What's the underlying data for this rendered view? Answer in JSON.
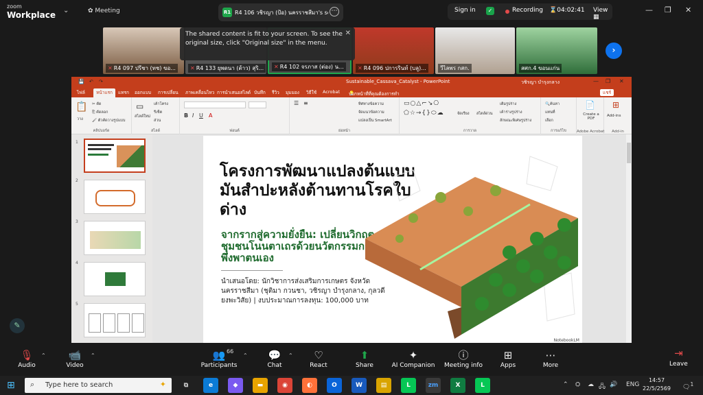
{
  "zoom": {
    "logo_top": "zoom",
    "logo_bottom": "Workplace",
    "meeting_label": "Meeting",
    "share_badge": "R1",
    "share_title": "R4 106 วชิรญา (ป้อ) นครราชสีมา's scr",
    "sign_in": "Sign in",
    "recording_label": "Recording",
    "elapsed_time": "04:02:41",
    "view_label": "View",
    "tooltip": "The shared content is fit to your screen. To see the original size, click \"Original size\" in the menu.",
    "participants": [
      {
        "name": "R4 097 ปรีชา (ทช) ขอ..."
      },
      {
        "name": "R4 133 ยุพดนา (ต้าว) สุริ..."
      },
      {
        "name": "R4 102 จรภาส (ต่อง) น..."
      },
      {
        "name": "R4 096 ปการรินท์ (บลู)..."
      },
      {
        "name": "วีไลพร กสก."
      },
      {
        "name": "สศก.4 ขอนแก่น"
      }
    ]
  },
  "ppt": {
    "title": "Sustainable_Cassava_Catalyst - PowerPoint",
    "user": "วชิรญา บำรุงกลาง",
    "tabs": [
      "ไฟล์",
      "หน้าแรก",
      "แทรก",
      "ออกแบบ",
      "การเปลี่ยน",
      "ภาพเคลื่อนไหว",
      "การนำเสนอสไลด์",
      "บันทึก",
      "รีวิว",
      "มุมมอง",
      "วิธีใช้",
      "Acrobat",
      "บอกหน้าที่ที่คุณต้องการทำ"
    ],
    "share_btn": "แชร์",
    "groups": {
      "clipboard": "คลิปบอร์ด",
      "slides": "สไลด์",
      "font": "ฟอนต์",
      "paragraph": "ย่อหน้า",
      "drawing": "การวาด",
      "editing": "การแก้ไข",
      "adobe": "Adobe Acrobat",
      "addins": "Add-in"
    },
    "buttons": {
      "paste": "วาง",
      "cut": "ตัด",
      "copy": "คัดลอก",
      "format_painter": "ตัวคัดวางรูปแบบ",
      "new_slide": "สไลด์ใหม่",
      "layout": "เค้าโครง",
      "reset": "รีเซ็ต",
      "section": "ส่วน",
      "text_direction": "ทิศทางข้อความ",
      "align_text": "จัดแนวข้อความ",
      "smartart": "แปลงเป็น SmartArt",
      "arrange": "จัดเรียง",
      "quick_styles": "สไตล์ด่วน",
      "shape_fill": "เติมรูปร่าง",
      "shape_outline": "เค้าร่างรูปร่าง",
      "shape_effects": "ลักษณะพิเศษรูปร่าง",
      "find": "ค้นหา",
      "replace": "แทนที่",
      "select": "เลือก",
      "create_pdf": "Create a PDF",
      "addins": "Add-ins"
    },
    "slide_numbers": [
      "1",
      "2",
      "3",
      "4",
      "5"
    ],
    "slide": {
      "title": "โครงการพัฒนาแปลงต้นแบบมันสำปะหลังต้านทานโรคใบด่าง",
      "subtitle": "จากรากสู่ความยั่งยืน: เปลี่ยนวิกฤตชุมชนโนนตาเถรด้วยนวัตกรรมการพึ่งพาตนเอง",
      "presenter": "นำเสนอโดย: นักวิชาการส่งเสริมการเกษตร จังหวัดนครราชสีมา (ชุติมา กวนชา, วชิรญา บำรุงกลาง, กุลวดี ยงพะวิสัย) | งบประมาณการลงทุน: 100,000 บาท",
      "watermark": "NotebookLM"
    }
  },
  "toolbar": {
    "audio": "Audio",
    "video": "Video",
    "participants": "Participants",
    "participant_count": "66",
    "chat": "Chat",
    "react": "React",
    "share": "Share",
    "ai_companion": "AI Companion",
    "meeting_info": "Meeting info",
    "apps": "Apps",
    "more": "More",
    "leave": "Leave"
  },
  "taskbar": {
    "search_placeholder": "Type here to search",
    "language": "ENG",
    "time": "14:57",
    "date": "22/5/2569",
    "notif_count": "1"
  },
  "colors": {
    "ppt_accent": "#c43e1c",
    "zoom_blue": "#0e72ed",
    "rec_red": "#e24a4a",
    "share_green": "#1fa64b"
  }
}
